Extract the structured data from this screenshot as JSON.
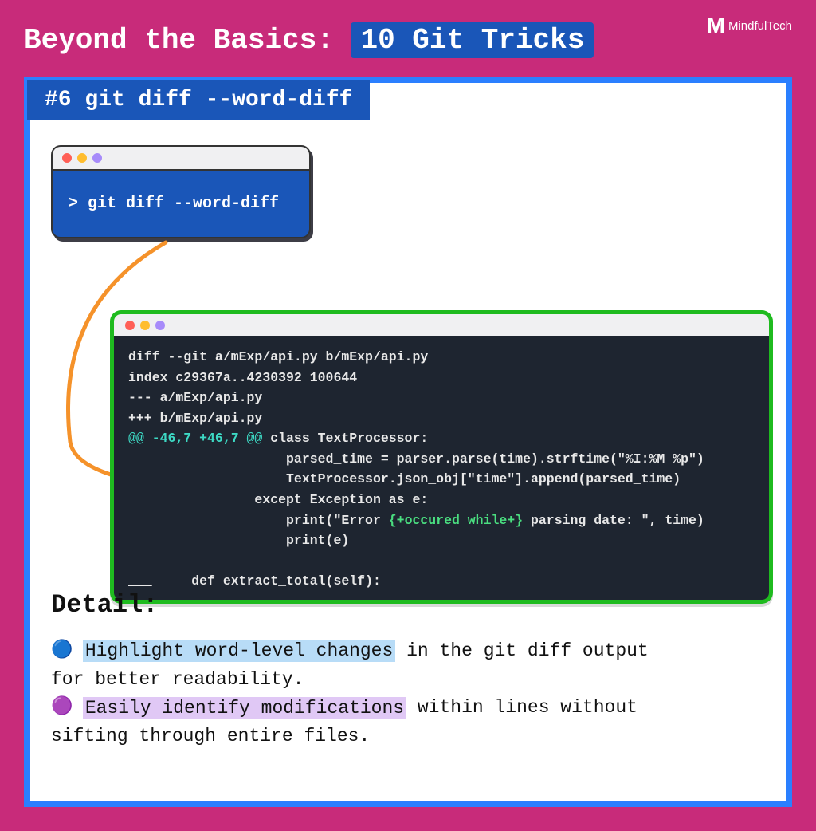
{
  "brand": "MindfulTech",
  "title": {
    "prefix": "Beyond the Basics:",
    "highlight": "10 Git Tricks"
  },
  "subtitle": "#6 git diff --word-diff",
  "terminal_small": {
    "command": "> git diff --word-diff"
  },
  "terminal_big": {
    "line1": "diff --git a/mExp/api.py b/mExp/api.py",
    "line2": "index c29367a..4230392 100644",
    "line3": "--- a/mExp/api.py",
    "line4": "+++ b/mExp/api.py",
    "hunk": "@@ -46,7 +46,7 @@",
    "hunk_suffix": " class TextProcessor:",
    "line6": "                    parsed_time = parser.parse(time).strftime(\"%I:%M %p\")",
    "line7": "                    TextProcessor.json_obj[\"time\"].append(parsed_time)",
    "line8": "                except Exception as e:",
    "line9_a": "                    print(\"Error ",
    "line9_added": "{+occured while+}",
    "line9_b": " parsing date: \", time)",
    "line10": "                    print(e)",
    "line11": "    def extract_total(self):"
  },
  "detail": {
    "heading": "Detail:",
    "bullet1": {
      "highlight": "Highlight word-level changes",
      "rest1": " in the git diff output",
      "rest2": "for better readability."
    },
    "bullet2": {
      "highlight": "Easily identify modifications",
      "rest1": " within lines without",
      "rest2": "sifting through entire files."
    }
  }
}
